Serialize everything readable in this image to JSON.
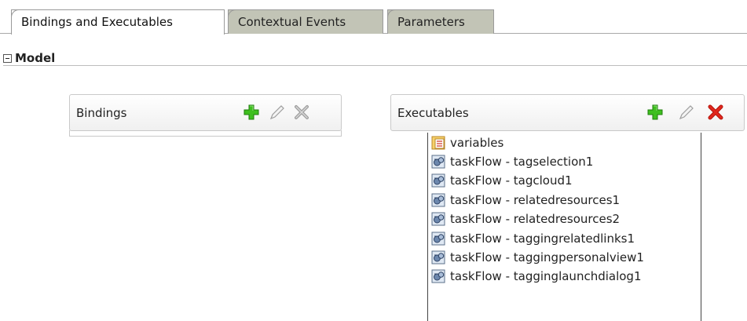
{
  "tabs": [
    {
      "label": "Bindings and Executables",
      "active": true
    },
    {
      "label": "Contextual Events",
      "active": false
    },
    {
      "label": "Parameters",
      "active": false
    }
  ],
  "model": {
    "title": "Model"
  },
  "bindings_panel": {
    "title": "Bindings",
    "icons": [
      "add-icon",
      "edit-icon",
      "delete-icon"
    ]
  },
  "executables_panel": {
    "title": "Executables",
    "icons": [
      "add-icon",
      "edit-icon",
      "delete-icon"
    ],
    "items": [
      {
        "label": "variables",
        "icon": "variables-icon"
      },
      {
        "label": "taskFlow - tagselection1",
        "icon": "taskflow-icon"
      },
      {
        "label": "taskFlow - tagcloud1",
        "icon": "taskflow-icon"
      },
      {
        "label": "taskFlow - relatedresources1",
        "icon": "taskflow-icon"
      },
      {
        "label": "taskFlow - relatedresources2",
        "icon": "taskflow-icon"
      },
      {
        "label": "taskFlow - taggingrelatedlinks1",
        "icon": "taskflow-icon"
      },
      {
        "label": "taskFlow - taggingpersonalview1",
        "icon": "taskflow-icon"
      },
      {
        "label": "taskFlow - tagginglaunchdialog1",
        "icon": "taskflow-icon"
      }
    ]
  },
  "colors": {
    "add_icon": "#3fbf1f",
    "delete_active": "#e1261c",
    "disabled_icon": "#9e9e9e",
    "inactive_tab": "#c2c4b6"
  }
}
